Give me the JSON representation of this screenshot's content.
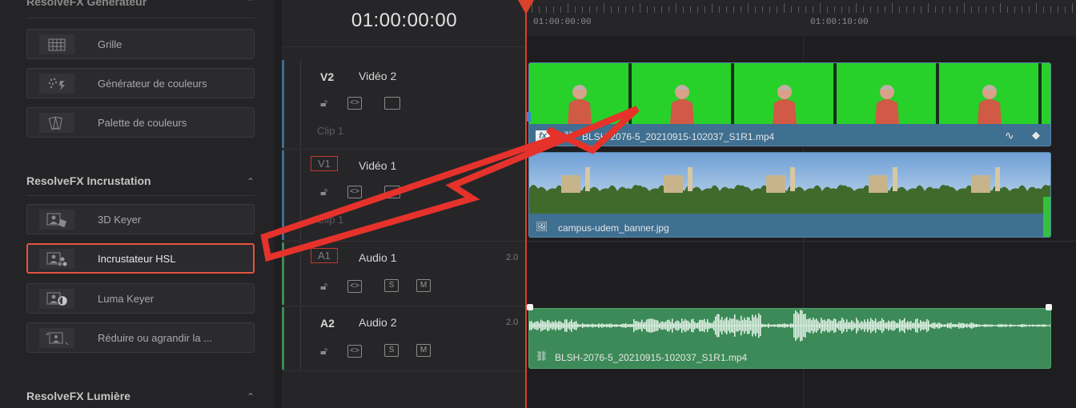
{
  "effects_panel": {
    "partial_title": "ResolveFX Générateur",
    "generator_items": [
      {
        "label": "Grille",
        "icon": "grid-icon"
      },
      {
        "label": "Générateur de couleurs",
        "icon": "color-generator-icon"
      },
      {
        "label": "Palette de couleurs",
        "icon": "color-palette-icon"
      }
    ],
    "keying_section": {
      "title": "ResolveFX Incrustation",
      "items": [
        {
          "label": "3D Keyer",
          "icon": "3d-keyer-icon"
        },
        {
          "label": "Incrustateur HSL",
          "icon": "hsl-keyer-icon",
          "selected": true
        },
        {
          "label": "Luma Keyer",
          "icon": "luma-keyer-icon"
        },
        {
          "label": "Réduire ou agrandir la ...",
          "icon": "resize-icon"
        }
      ]
    },
    "light_section": {
      "title": "ResolveFX Lumière"
    }
  },
  "timeline": {
    "timecode": "01:00:00:00",
    "ruler_labels": [
      "01:00:00:00",
      "01:00:10:00"
    ],
    "tracks": [
      {
        "id": "V2",
        "name": "Vidéo 2",
        "clip_placeholder": "Clip 1",
        "type": "video"
      },
      {
        "id": "V1",
        "name": "Vidéo 1",
        "clip_placeholder": "Clip 1",
        "type": "video"
      },
      {
        "id": "A1",
        "name": "Audio 1",
        "channels": "2.0",
        "type": "audio",
        "solo": "S",
        "mute": "M"
      },
      {
        "id": "A2",
        "name": "Audio 2",
        "channels": "2.0",
        "type": "audio",
        "solo": "S",
        "mute": "M"
      }
    ],
    "clips": {
      "v2_clip": "BLSH-2076-5_20210915-102037_S1R1.mp4",
      "v2_fx_badge": "fx",
      "v1_clip": "campus-udem_banner.jpg",
      "a2_clip": "BLSH-2076-5_20210915-102037_S1R1.mp4"
    }
  },
  "colors": {
    "accent_red": "#d9412b",
    "video_clip": "#3f6f91",
    "audio_clip": "#3c8a57",
    "green_screen": "#27d12a"
  }
}
